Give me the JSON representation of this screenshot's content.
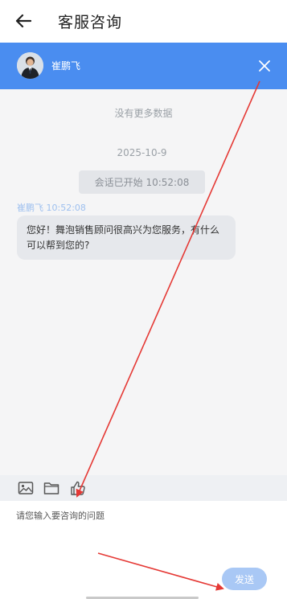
{
  "nav": {
    "back_icon": "arrow-left-icon",
    "title": "客服咨询"
  },
  "chat_header": {
    "agent_name": "崔鹏飞",
    "background_color": "#4a8df0",
    "close_icon": "close-icon"
  },
  "chat": {
    "no_more_text": "没有更多数据",
    "date": "2025-10-9",
    "session_started": "会话已开始 10:52:08",
    "messages": [
      {
        "sender": "崔鹏飞 10:52:08",
        "text": "您好！舞泡销售顾问很高兴为您服务，有什么可以帮到您的?"
      }
    ]
  },
  "toolbar": {
    "icons": [
      "image-icon",
      "folder-icon",
      "thumbs-up-icon"
    ]
  },
  "composer": {
    "placeholder": "请您输入要咨询的问题",
    "send_label": "发送"
  },
  "annotation_color": "#e53935"
}
